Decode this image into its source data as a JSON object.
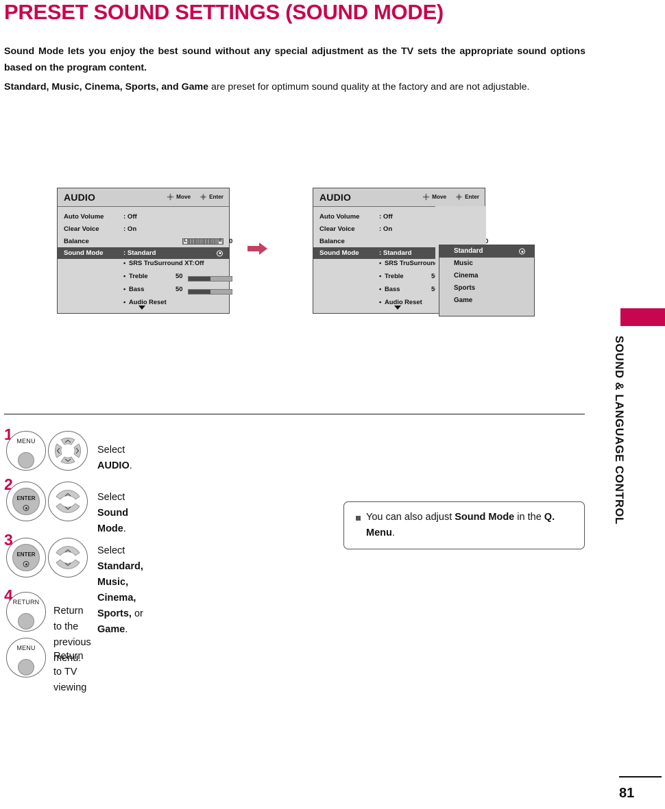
{
  "page": {
    "title": "PRESET SOUND SETTINGS (SOUND MODE)",
    "title_color": "#c8064f",
    "number": "81",
    "side_label": "SOUND & LANGUAGE CONTROL"
  },
  "intro": {
    "paragraph1": "Sound Mode lets you enjoy the best sound without any special adjustment as the TV sets the appropriate sound options based on the program content.",
    "line2_modes": "Standard, Music, Cinema, Sports, and Game",
    "line2_rest": " are preset for optimum sound quality at the factory and are not adjustable."
  },
  "osd": {
    "title": "AUDIO",
    "hint_move": "Move",
    "hint_enter": "Enter",
    "rows": [
      {
        "label": "Auto Volume",
        "value": ": Off"
      },
      {
        "label": "Clear Voice",
        "value": ": On"
      },
      {
        "label": "Balance",
        "value": "0"
      },
      {
        "label": "Sound Mode",
        "value": ": Standard"
      }
    ],
    "balance_value": "0",
    "balance_left_cap": "L",
    "balance_right_cap": "R",
    "sub_items": [
      {
        "bullet": "•",
        "label": "SRS TruSurround XT:",
        "value": "Off"
      },
      {
        "bullet": "•",
        "label": "Treble",
        "value": "50",
        "level": 50
      },
      {
        "bullet": "•",
        "label": "Bass",
        "value": "50",
        "level": 50
      },
      {
        "bullet": "•",
        "label": "Audio Reset",
        "value": ""
      }
    ],
    "scroll_caret": "▼"
  },
  "dropdown": {
    "options": [
      "Standard",
      "Music",
      "Cinema",
      "Sports",
      "Game"
    ],
    "selected": "Standard"
  },
  "steps": [
    {
      "num": "1",
      "button_label": "MENU",
      "button_type": "plain",
      "nav_type": "four-way",
      "text_prefix": "Select ",
      "text_bold": "AUDIO",
      "text_suffix": "."
    },
    {
      "num": "2",
      "button_label": "ENTER",
      "button_type": "enter",
      "nav_type": "up-down",
      "text_prefix": "Select ",
      "text_bold": "Sound Mode",
      "text_suffix": "."
    },
    {
      "num": "3",
      "button_label": "ENTER",
      "button_type": "enter",
      "nav_type": "up-down",
      "text_prefix": "Select ",
      "text_bold": "Standard, Music, Cinema, Sports,",
      "text_suffix": " or ",
      "text_bold2": "Game",
      "text_end": "."
    },
    {
      "num": "4",
      "button_label": "RETURN",
      "button_type": "plain",
      "nav_type": "none",
      "text_prefix": "Return to the previous menu.",
      "text_bold": "",
      "text_suffix": ""
    },
    {
      "num": "",
      "button_label": "MENU",
      "button_type": "plain",
      "nav_type": "none",
      "text_prefix": "Return to TV viewing",
      "text_bold": "",
      "text_suffix": ""
    }
  ],
  "note": {
    "prefix": "You can also adjust ",
    "bold1": "Sound Mode",
    "mid": " in the ",
    "bold2": "Q. Menu",
    "suffix": "."
  }
}
